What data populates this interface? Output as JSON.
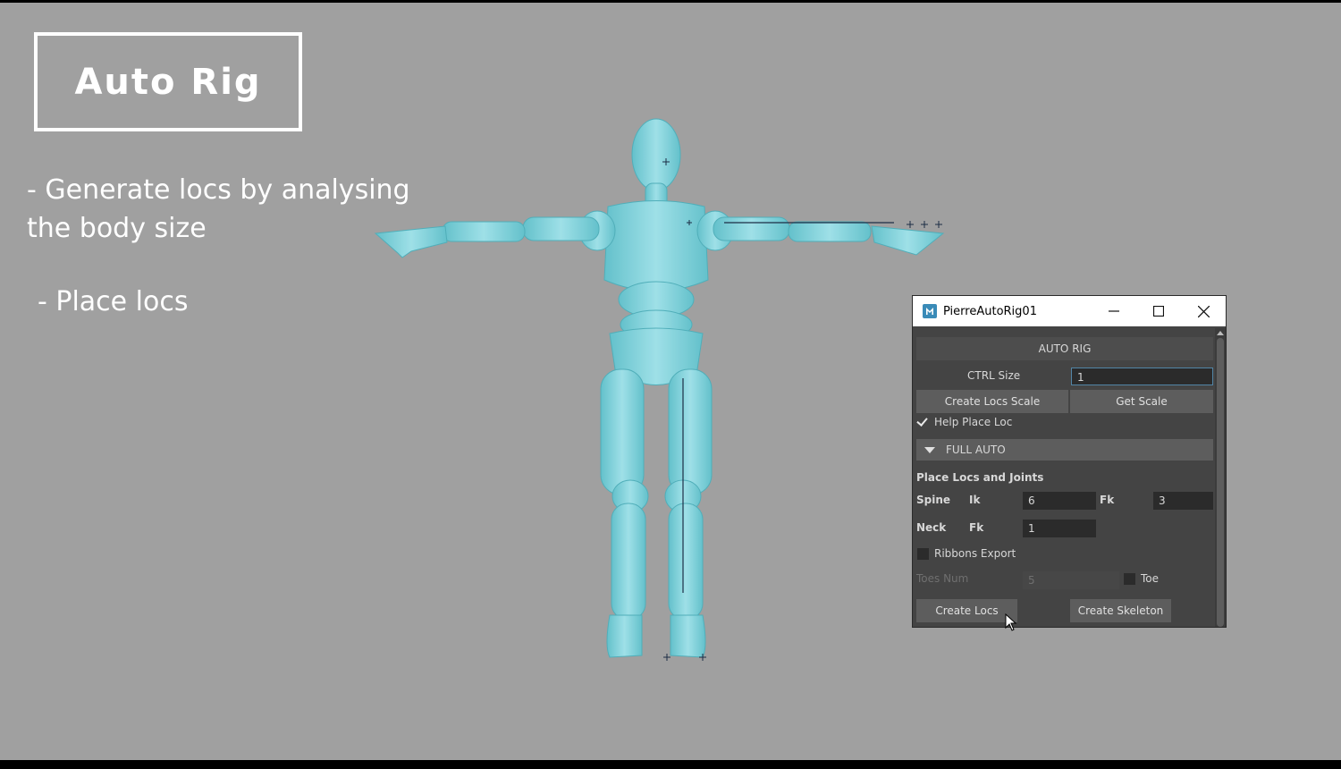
{
  "overlay": {
    "title": "Auto Rig",
    "bullets": [
      " - Generate locs by analysing the body size",
      " - Place locs"
    ]
  },
  "window": {
    "title": "PierreAutoRig01",
    "header": "AUTO RIG",
    "ctrl_size_label": "CTRL Size",
    "ctrl_size_value": "1",
    "create_locs_scale": "Create Locs Scale",
    "get_scale": "Get Scale",
    "help_place_loc": "Help Place Loc",
    "help_place_loc_checked": true,
    "full_auto": "FULL AUTO",
    "place_locs_joints": "Place Locs and Joints",
    "spine_label": "Spine",
    "ik_label": "Ik",
    "spine_ik_value": "6",
    "fk_label": "Fk",
    "spine_fk_value": "3",
    "neck_label": "Neck",
    "neck_fk_label": "Fk",
    "neck_fk_value": "1",
    "ribbons_export": "Ribbons Export",
    "ribbons_checked": false,
    "toes_num_label": "Toes Num",
    "toes_num_value": "5",
    "toe_label": "Toe",
    "toe_checked": false,
    "create_locs": "Create Locs",
    "create_skeleton": "Create Skeleton"
  },
  "colors": {
    "viewport_bg": "#a0a0a0",
    "mannequin": "#7fd6df",
    "panel_bg": "#444444"
  }
}
